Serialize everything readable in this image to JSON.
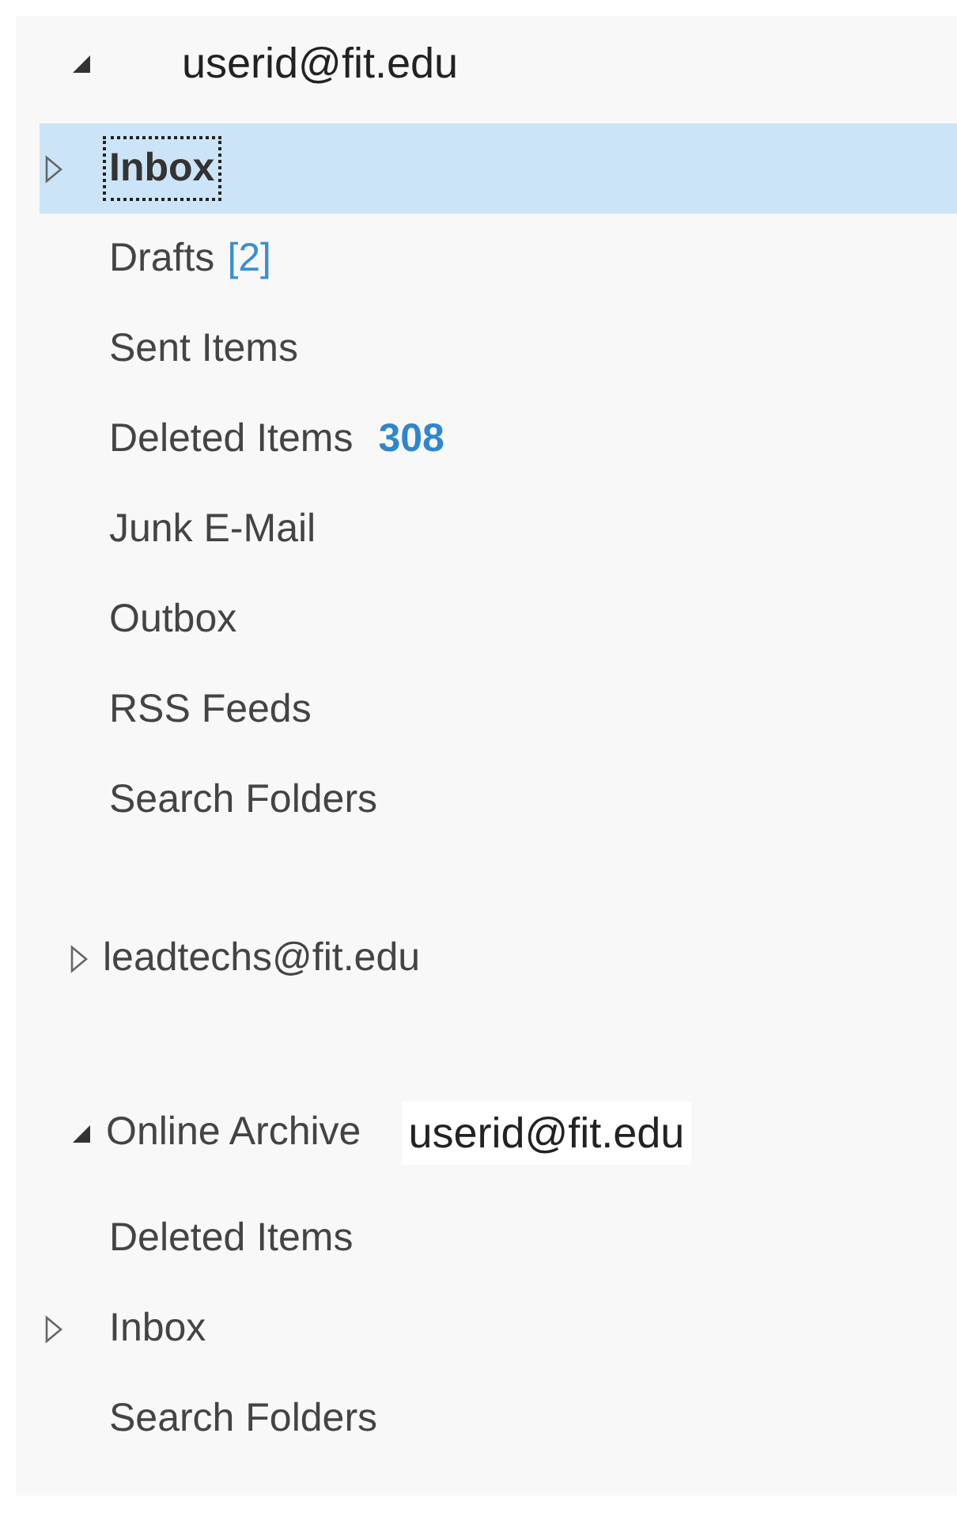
{
  "accounts": [
    {
      "name": "userid@fit.edu",
      "expanded": true,
      "folders": [
        {
          "name": "Inbox",
          "has_subfolders": true,
          "selected": true,
          "bold": true
        },
        {
          "name": "Drafts",
          "has_subfolders": false,
          "selected": false,
          "bold": false,
          "count": {
            "text": "[2]",
            "bold": false
          }
        },
        {
          "name": "Sent Items",
          "has_subfolders": false,
          "selected": false,
          "bold": false
        },
        {
          "name": "Deleted Items",
          "has_subfolders": false,
          "selected": false,
          "bold": false,
          "count": {
            "text": "308",
            "bold": true
          }
        },
        {
          "name": "Junk E-Mail",
          "has_subfolders": false,
          "selected": false,
          "bold": false
        },
        {
          "name": "Outbox",
          "has_subfolders": false,
          "selected": false,
          "bold": false
        },
        {
          "name": "RSS Feeds",
          "has_subfolders": false,
          "selected": false,
          "bold": false
        },
        {
          "name": "Search Folders",
          "has_subfolders": false,
          "selected": false,
          "bold": false
        }
      ]
    },
    {
      "name": "leadtechs@fit.edu",
      "expanded": false
    },
    {
      "name": "Online Archive",
      "suffix": "userid@fit.edu",
      "expanded": true,
      "folders": [
        {
          "name": "Deleted Items",
          "has_subfolders": false,
          "selected": false,
          "bold": false
        },
        {
          "name": "Inbox",
          "has_subfolders": true,
          "selected": false,
          "bold": false
        },
        {
          "name": "Search Folders",
          "has_subfolders": false,
          "selected": false,
          "bold": false
        }
      ]
    }
  ]
}
